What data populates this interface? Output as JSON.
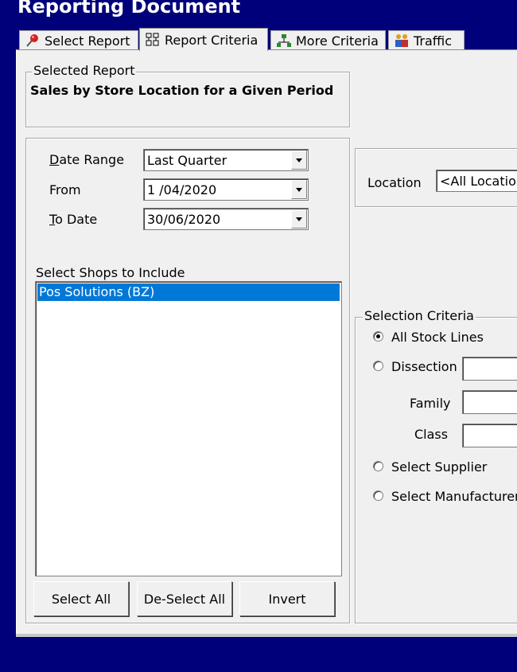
{
  "window": {
    "title": "Reporting Document"
  },
  "tabs": [
    {
      "label": "Select Report",
      "icon": "pin-icon"
    },
    {
      "label": "Report Criteria",
      "icon": "criteria-icon"
    },
    {
      "label": "More Criteria",
      "icon": "network-icon"
    },
    {
      "label": "Traffic",
      "icon": "people-icon"
    }
  ],
  "selected_report": {
    "legend": "Selected Report",
    "name": "Sales by Store Location for a Given Period"
  },
  "dates": {
    "date_range_label": "Date Range",
    "date_range_value": "Last Quarter",
    "from_label": "From",
    "from_value": "1 /04/2020",
    "to_label": "To Date",
    "to_value": "30/06/2020"
  },
  "shops": {
    "label": "Select Shops to Include",
    "items": [
      "Pos Solutions (BZ)"
    ],
    "selected_index": 0
  },
  "buttons": {
    "select_all": "Select All",
    "deselect_all": "De-Select All",
    "invert": "Invert"
  },
  "location": {
    "label": "Location",
    "value": "<All Location"
  },
  "selection_criteria": {
    "legend": "Selection Criteria",
    "all_stock": "All Stock Lines",
    "dissection": "Dissection",
    "family": "Family",
    "class": "Class",
    "supplier": "Select Supplier",
    "manufacturer": "Select Manufacturer",
    "selected": "all_stock"
  },
  "colors": {
    "background": "#00007a",
    "panel": "#f0f0f0",
    "selection": "#0078d7"
  }
}
